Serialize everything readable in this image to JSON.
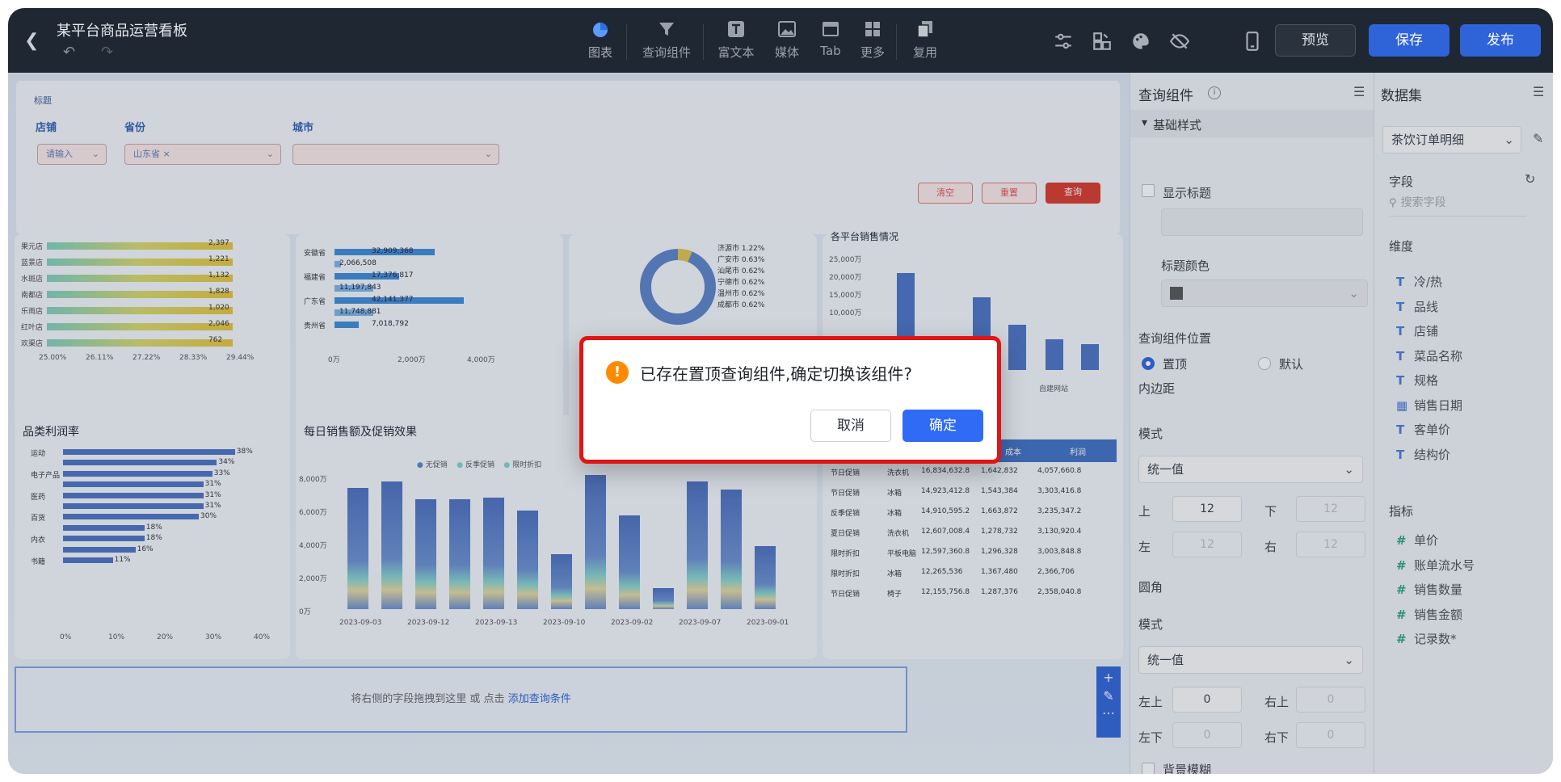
{
  "header": {
    "title": "某平台商品运营看板",
    "tools": [
      {
        "label": "图表",
        "icon": "pie-chart-icon"
      },
      {
        "label": "查询组件",
        "icon": "filter-icon"
      },
      {
        "label": "富文本",
        "icon": "text-icon"
      },
      {
        "label": "媒体",
        "icon": "image-icon"
      },
      {
        "label": "Tab",
        "icon": "tab-icon"
      },
      {
        "label": "更多",
        "icon": "grid-icon"
      },
      {
        "label": "复用",
        "icon": "copy-icon"
      }
    ],
    "preview": "预览",
    "save": "保存",
    "publish": "发布"
  },
  "query": {
    "title": "标题",
    "store_label": "店铺",
    "province_label": "省份",
    "city_label": "城市",
    "store_placeholder": "请输入",
    "province_value": "山东省",
    "btn_clear": "清空",
    "btn_reset": "重置",
    "btn_query": "查询"
  },
  "charts": {
    "profit_title": "品类利润率",
    "daily_title": "每日销售额及促销效果",
    "daily_legend": [
      "无促销",
      "反季促销",
      "限时折扣"
    ],
    "store_rows": [
      {
        "name": "果元店",
        "value": "2,397"
      },
      {
        "name": "蓝景店",
        "value": "1,221"
      },
      {
        "name": "水斑店",
        "value": "1,132"
      },
      {
        "name": "南都店",
        "value": "1,828"
      },
      {
        "name": "乐雨店",
        "value": "1,020"
      },
      {
        "name": "红叶店",
        "value": "2,046"
      },
      {
        "name": "欢渠店",
        "value": "762"
      }
    ],
    "store_ticks": [
      "25.00%",
      "26.11%",
      "27.22%",
      "28.33%",
      "29.44%"
    ],
    "prov_rows": [
      {
        "name": "安徽省",
        "value": "32,909,368"
      },
      {
        "name": "",
        "value": "2,066,508"
      },
      {
        "name": "福建省",
        "value": "17,376,817"
      },
      {
        "name": "",
        "value": "11,197,843"
      },
      {
        "name": "广东省",
        "value": "42,141,377"
      },
      {
        "name": "",
        "value": "11,748,881"
      },
      {
        "name": "贵州省",
        "value": "7,018,792"
      }
    ],
    "prov_ticks": [
      "0万",
      "2,000万",
      "4,000万"
    ],
    "donut_items": [
      "济源市 1.22%",
      "广安市 0.63%",
      "汕尾市 0.62%",
      "宁德市 0.62%",
      "温州市 0.62%",
      "成都市 0.62%"
    ],
    "channel_title": "各平台销售情况",
    "channel_ticks": [
      "25,000万",
      "20,000万",
      "15,000万",
      "10,000万"
    ],
    "channel_xlabel": "自建网站",
    "profit_cats": [
      "运动",
      "",
      "电子产品",
      "",
      "医药",
      "",
      "百货",
      "",
      "内衣",
      "",
      "书籍"
    ],
    "profit_vals": [
      "38%",
      "34%",
      "33%",
      "31%",
      "31%",
      "31%",
      "30%",
      "18%",
      "18%",
      "16%",
      "11%"
    ],
    "profit_ticks": [
      "0%",
      "10%",
      "20%",
      "30%",
      "40%"
    ],
    "daily_yticks": [
      "8,000万",
      "6,000万",
      "4,000万",
      "2,000万",
      "0万"
    ],
    "daily_xticks": [
      "2023-09-03",
      "2023-09-12",
      "2023-09-13",
      "2023-09-10",
      "2023-09-02",
      "2023-09-07",
      "2023-09-01"
    ],
    "table_head": [
      "成本",
      "利润"
    ],
    "table_rows": [
      [
        "节日促销",
        "洗衣机",
        "16,834,632.8",
        "1,642,832",
        "4,057,660.8"
      ],
      [
        "节日促销",
        "冰箱",
        "14,923,412.8",
        "1,543,384",
        "3,303,416.8"
      ],
      [
        "反季促销",
        "冰箱",
        "14,910,595.2",
        "1,663,872",
        "3,235,347.2"
      ],
      [
        "夏日促销",
        "洗衣机",
        "12,607,008.4",
        "1,278,732",
        "3,130,920.4"
      ],
      [
        "限时折扣",
        "平板电脑",
        "12,597,360.8",
        "1,296,328",
        "3,003,848.8"
      ],
      [
        "限时折扣",
        "冰箱",
        "12,265,536",
        "1,367,480",
        "2,366,706"
      ],
      [
        "节日促销",
        "椅子",
        "12,155,756.8",
        "1,287,376",
        "2,358,040.8"
      ]
    ]
  },
  "placeholder": {
    "text": "将右侧的字段拖拽到这里 或 点击 ",
    "link": "添加查询条件"
  },
  "panel": {
    "title": "查询组件",
    "section": "基础样式",
    "show_title": "显示标题",
    "title_color": "标题颜色",
    "position": "查询组件位置",
    "pos_top": "置顶",
    "pos_default": "默认",
    "padding": "内边距",
    "mode": "模式",
    "mode_value": "统一值",
    "top": "上",
    "bottom": "下",
    "left": "左",
    "right": "右",
    "pad_top": "12",
    "pad_bottom": "12",
    "pad_left": "12",
    "pad_right": "12",
    "radius": "圆角",
    "mode2": "模式",
    "mode2_value": "统一值",
    "tl": "左上",
    "tr": "右上",
    "bl": "左下",
    "br": "右下",
    "r_tl": "0",
    "r_tr": "0",
    "r_bl": "0",
    "r_br": "0",
    "blur": "背景模糊"
  },
  "dataset": {
    "title": "数据集",
    "selected": "茶饮订单明细",
    "fields_label": "字段",
    "search_placeholder": "搜索字段",
    "dim_label": "维度",
    "dims": [
      "冷/热",
      "品线",
      "店铺",
      "菜品名称",
      "规格",
      "销售日期",
      "客单价",
      "结构价"
    ],
    "metric_label": "指标",
    "metrics": [
      "单价",
      "账单流水号",
      "销售数量",
      "销售金额",
      "记录数*"
    ]
  },
  "dialog": {
    "message": "已存在置顶查询组件,确定切换该组件?",
    "cancel": "取消",
    "ok": "确定"
  }
}
